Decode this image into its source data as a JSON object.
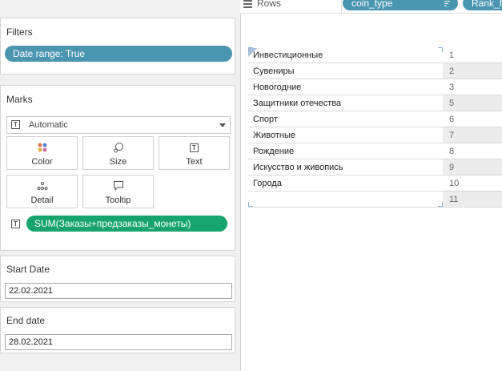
{
  "filters": {
    "title": "Filters",
    "pill": "Date range: True"
  },
  "marks": {
    "title": "Marks",
    "mark_type": "Automatic",
    "buttons": {
      "color": "Color",
      "size": "Size",
      "text": "Text",
      "detail": "Detail",
      "tooltip": "Tooltip"
    },
    "measure_pill": "SUM(Заказы+предзаказы_монеты)",
    "text_icon_glyph": "T"
  },
  "parameters": {
    "start": {
      "label": "Start Date",
      "value": "22.02.2021"
    },
    "end": {
      "label": "End date",
      "value": "28.02.2021"
    }
  },
  "shelf": {
    "rows_label": "Rows",
    "pills": [
      "coin_type",
      "Rank_t"
    ]
  },
  "table": {
    "rows": [
      {
        "name": "Инвестиционные",
        "rank": "1"
      },
      {
        "name": "Сувениры",
        "rank": "2"
      },
      {
        "name": "Новогодние",
        "rank": "3"
      },
      {
        "name": "Защитники отечества",
        "rank": "5"
      },
      {
        "name": "Спорт",
        "rank": "6"
      },
      {
        "name": "Животные",
        "rank": "7"
      },
      {
        "name": "Рождение",
        "rank": "8"
      },
      {
        "name": "Искусство и живопись",
        "rank": "9"
      },
      {
        "name": "Города",
        "rank": "10"
      },
      {
        "name": "",
        "rank": "11"
      }
    ]
  },
  "colors": {
    "dimension_pill": "#4a96b0",
    "measure_pill": "#16a46c"
  }
}
